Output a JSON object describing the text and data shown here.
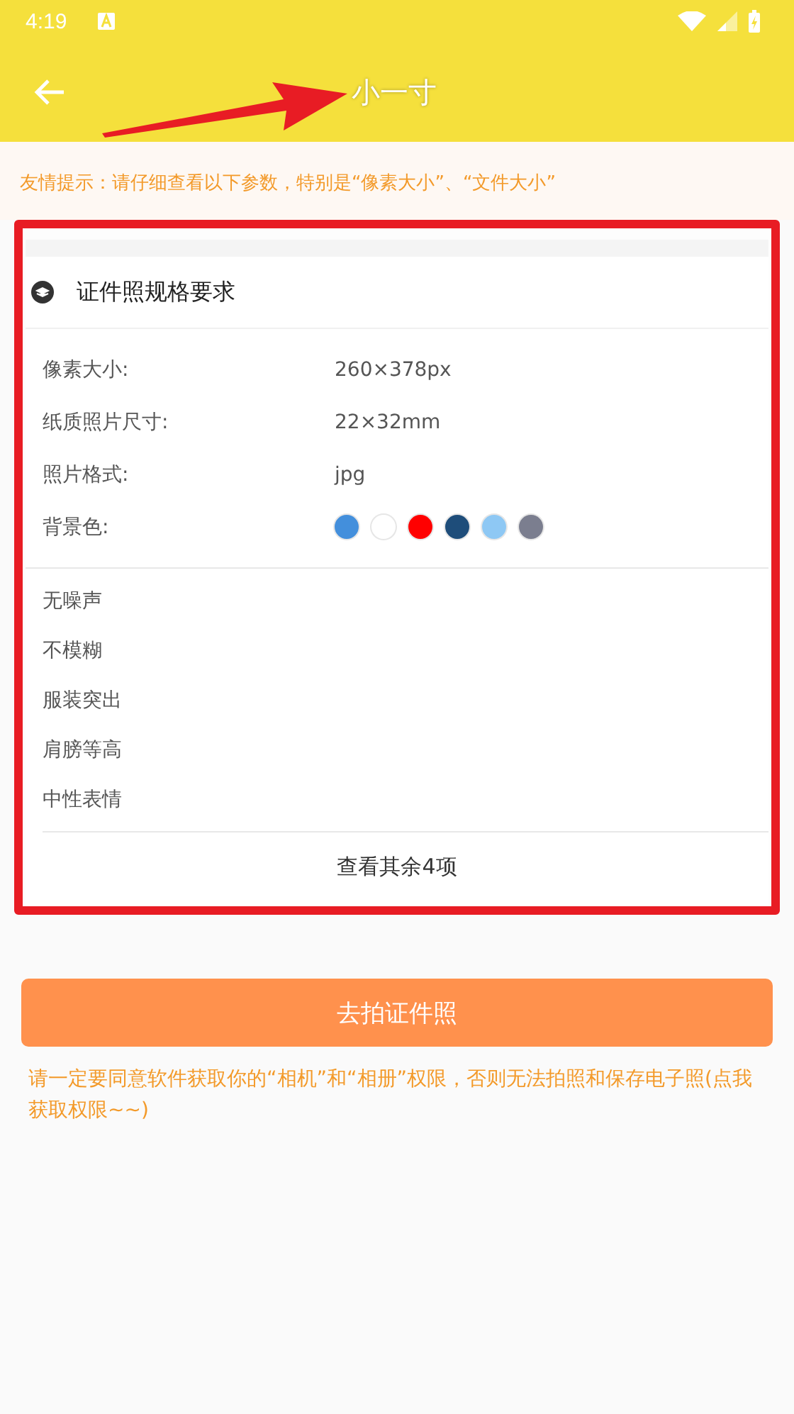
{
  "status_bar": {
    "time": "4:19"
  },
  "app_bar": {
    "title": "小一寸"
  },
  "tip": "友情提示：请仔细查看以下参数，特别是“像素大小”、“文件大小”",
  "card": {
    "title": "证件照规格要求",
    "specs": [
      {
        "kind": "text",
        "label": "像素大小:",
        "value": "260×378px"
      },
      {
        "kind": "text",
        "label": "纸质照片尺寸:",
        "value": "22×32mm"
      },
      {
        "kind": "text",
        "label": "照片格式:",
        "value": "jpg"
      },
      {
        "kind": "colors",
        "label": "背景色:",
        "colors": [
          {
            "color": "#438fdc"
          },
          {
            "color": "#ffffff"
          },
          {
            "color": "#ff0000"
          },
          {
            "color": "#1e4d7a"
          },
          {
            "color": "#8ec8f4"
          },
          {
            "color": "#7b7e8f"
          }
        ]
      }
    ],
    "requirements": [
      "无噪声",
      "不模糊",
      "服装突出",
      "肩膀等高",
      "中性表情"
    ],
    "more": "查看其余4项"
  },
  "button": "去拍证件照",
  "note": "请一定要同意软件获取你的“相机”和“相册”权限，否则无法拍照和保存电子照(点我获取权限~~)"
}
